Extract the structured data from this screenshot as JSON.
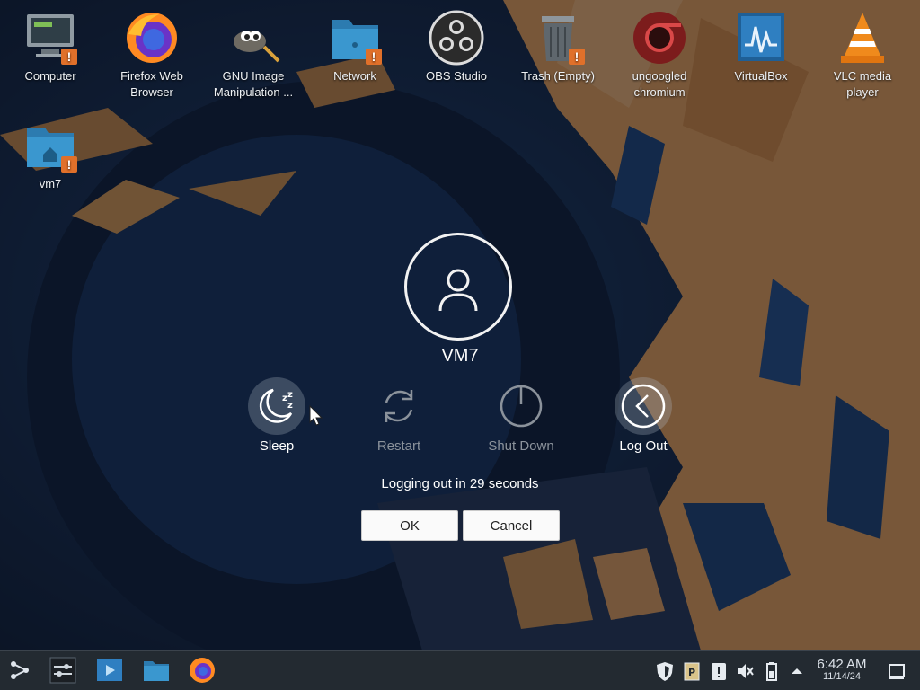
{
  "desktop": {
    "icons": [
      {
        "label": "Computer",
        "icon": "computer-icon"
      },
      {
        "label": "Firefox Web\nBrowser",
        "icon": "firefox-icon"
      },
      {
        "label": "GNU Image\nManipulation ...",
        "icon": "gimp-icon"
      },
      {
        "label": "Network",
        "icon": "network-folder-icon"
      },
      {
        "label": "OBS Studio",
        "icon": "obs-icon"
      },
      {
        "label": "Trash (Empty)",
        "icon": "trash-icon"
      },
      {
        "label": "ungoogled\nchromium",
        "icon": "chromium-icon"
      },
      {
        "label": "VirtualBox",
        "icon": "virtualbox-icon"
      },
      {
        "label": "VLC media\nplayer",
        "icon": "vlc-icon"
      },
      {
        "label": "vm7",
        "icon": "home-folder-icon"
      }
    ],
    "warning_badge": "!"
  },
  "logout_dialog": {
    "username": "VM7",
    "actions": [
      {
        "label": "Sleep",
        "icon": "sleep-icon",
        "enabled": true
      },
      {
        "label": "Restart",
        "icon": "restart-icon",
        "enabled": false
      },
      {
        "label": "Shut Down",
        "icon": "shutdown-icon",
        "enabled": false
      },
      {
        "label": "Log Out",
        "icon": "logout-icon",
        "enabled": true
      }
    ],
    "countdown_text": "Logging out in 29 seconds",
    "ok_label": "OK",
    "cancel_label": "Cancel"
  },
  "taskbar": {
    "launchers": [
      "app-launcher-icon",
      "system-settings-icon",
      "discover-icon",
      "file-manager-icon",
      "firefox-icon"
    ],
    "tray": [
      "security-shield-icon",
      "clipboard-icon",
      "notifications-icon",
      "volume-muted-icon",
      "battery-icon",
      "tray-expand-icon",
      "show-desktop-icon"
    ],
    "clock_time": "6:42 AM",
    "clock_date": "11/14/24"
  },
  "colors": {
    "wallpaper_blue": "#1a3a66",
    "wallpaper_orange": "#e9a35c",
    "taskbar_bg": "#232a31",
    "warning_orange": "#e0702a"
  }
}
